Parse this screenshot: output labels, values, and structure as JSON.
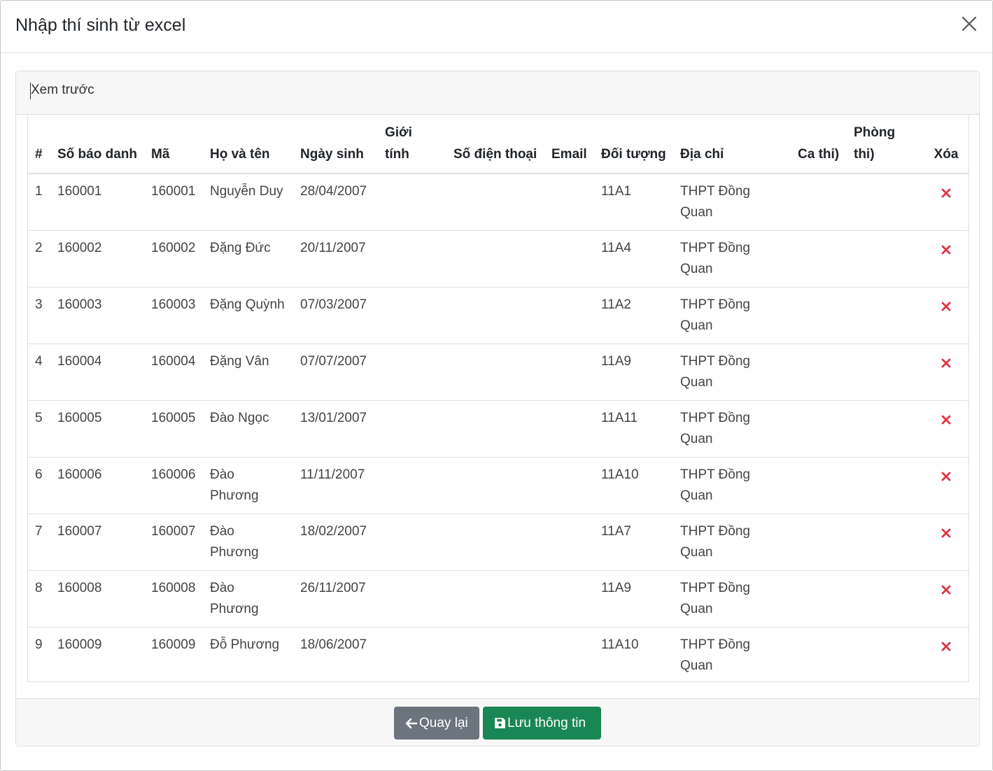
{
  "modal": {
    "title": "Nhập thí sinh từ excel"
  },
  "preview": {
    "label": "Xem trước"
  },
  "table": {
    "headers": {
      "index": "#",
      "sbd": "Số báo danh",
      "ma": "Mã",
      "ho_ten": "Họ và tên",
      "ngay_sinh": "Ngày sinh",
      "gioi_tinh": "Giới tính",
      "sdt": "Số điện thoại",
      "email": "Email",
      "doi_tuong": "Đối tượng",
      "dia_chi": "Địa chỉ",
      "ca_thi": "Ca thi)",
      "phong_thi": "Phòng thi)",
      "xoa": "Xóa"
    },
    "rows": [
      {
        "idx": "1",
        "sbd": "160001",
        "ma": "160001",
        "name": "Nguyễn Duy",
        "dob": "28/04/2007",
        "gender": "",
        "phone": "",
        "email": "",
        "group": "11A1",
        "address": "THPT Đồng Quan",
        "shift": "",
        "room": ""
      },
      {
        "idx": "2",
        "sbd": "160002",
        "ma": "160002",
        "name": "Đặng Đức",
        "dob": "20/11/2007",
        "gender": "",
        "phone": "",
        "email": "",
        "group": "11A4",
        "address": "THPT Đồng Quan",
        "shift": "",
        "room": ""
      },
      {
        "idx": "3",
        "sbd": "160003",
        "ma": "160003",
        "name": "Đặng Quỳnh",
        "dob": "07/03/2007",
        "gender": "",
        "phone": "",
        "email": "",
        "group": "11A2",
        "address": "THPT Đồng Quan",
        "shift": "",
        "room": ""
      },
      {
        "idx": "4",
        "sbd": "160004",
        "ma": "160004",
        "name": "Đặng Vân",
        "dob": "07/07/2007",
        "gender": "",
        "phone": "",
        "email": "",
        "group": "11A9",
        "address": "THPT Đồng Quan",
        "shift": "",
        "room": ""
      },
      {
        "idx": "5",
        "sbd": "160005",
        "ma": "160005",
        "name": "Đào Ngọc",
        "dob": "13/01/2007",
        "gender": "",
        "phone": "",
        "email": "",
        "group": "11A11",
        "address": "THPT Đồng Quan",
        "shift": "",
        "room": ""
      },
      {
        "idx": "6",
        "sbd": "160006",
        "ma": "160006",
        "name": "Đào Phương",
        "dob": "11/11/2007",
        "gender": "",
        "phone": "",
        "email": "",
        "group": "11A10",
        "address": "THPT Đồng Quan",
        "shift": "",
        "room": ""
      },
      {
        "idx": "7",
        "sbd": "160007",
        "ma": "160007",
        "name": "Đào Phương",
        "dob": "18/02/2007",
        "gender": "",
        "phone": "",
        "email": "",
        "group": "11A7",
        "address": "THPT Đồng Quan",
        "shift": "",
        "room": ""
      },
      {
        "idx": "8",
        "sbd": "160008",
        "ma": "160008",
        "name": "Đào Phương",
        "dob": "26/11/2007",
        "gender": "",
        "phone": "",
        "email": "",
        "group": "11A9",
        "address": "THPT Đồng Quan",
        "shift": "",
        "room": ""
      },
      {
        "idx": "9",
        "sbd": "160009",
        "ma": "160009",
        "name": "Đỗ Phương",
        "dob": "18/06/2007",
        "gender": "",
        "phone": "",
        "email": "",
        "group": "11A10",
        "address": "THPT Đồng Quan",
        "shift": "",
        "room": ""
      }
    ]
  },
  "footer": {
    "back_label": "Quay lại",
    "save_label": "Lưu thông tin"
  },
  "icons": {
    "close": "close-icon",
    "delete": "x-mark-icon",
    "back": "arrow-left-icon",
    "save": "floppy-disk-icon"
  },
  "colors": {
    "delete": "#dc3545",
    "back_button": "#6c757d",
    "save_button": "#198754"
  }
}
